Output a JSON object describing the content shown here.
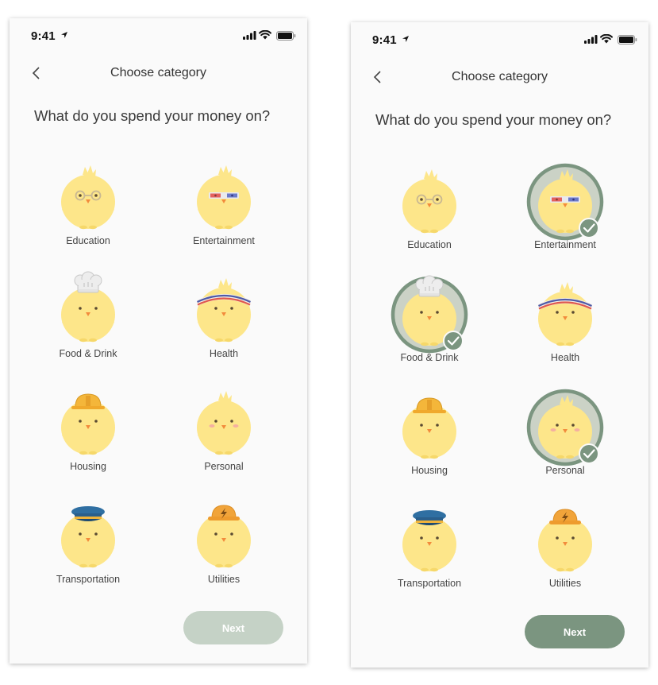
{
  "colors": {
    "chick": "#fde68a",
    "chick_dark": "#f6d86a",
    "beak": "#f28b3c",
    "ring": "#7b9580",
    "ring_bg": "#cbd2c6",
    "next_disabled": "#c5d2c6",
    "next_enabled": "#7b9580"
  },
  "screens": [
    {
      "status_time": "9:41",
      "title": "Choose category",
      "question": "What do you spend your money on?",
      "next_label": "Next",
      "next_enabled": false,
      "categories": [
        {
          "label": "Education",
          "icon": "glasses-chick-icon",
          "selected": false
        },
        {
          "label": "Entertainment",
          "icon": "3d-glasses-chick-icon",
          "selected": false
        },
        {
          "label": "Food & Drink",
          "icon": "chef-hat-chick-icon",
          "selected": false
        },
        {
          "label": "Health",
          "icon": "headband-chick-icon",
          "selected": false
        },
        {
          "label": "Housing",
          "icon": "hard-hat-chick-icon",
          "selected": false
        },
        {
          "label": "Personal",
          "icon": "blush-chick-icon",
          "selected": false
        },
        {
          "label": "Transportation",
          "icon": "pilot-cap-chick-icon",
          "selected": false
        },
        {
          "label": "Utilities",
          "icon": "lightning-hat-chick-icon",
          "selected": false
        }
      ]
    },
    {
      "status_time": "9:41",
      "title": "Choose category",
      "question": "What do you spend your money on?",
      "next_label": "Next",
      "next_enabled": true,
      "categories": [
        {
          "label": "Education",
          "icon": "glasses-chick-icon",
          "selected": false
        },
        {
          "label": "Entertainment",
          "icon": "3d-glasses-chick-icon",
          "selected": true
        },
        {
          "label": "Food & Drink",
          "icon": "chef-hat-chick-icon",
          "selected": true
        },
        {
          "label": "Health",
          "icon": "headband-chick-icon",
          "selected": false
        },
        {
          "label": "Housing",
          "icon": "hard-hat-chick-icon",
          "selected": false
        },
        {
          "label": "Personal",
          "icon": "blush-chick-icon",
          "selected": true
        },
        {
          "label": "Transportation",
          "icon": "pilot-cap-chick-icon",
          "selected": false
        },
        {
          "label": "Utilities",
          "icon": "lightning-hat-chick-icon",
          "selected": false
        }
      ]
    }
  ]
}
